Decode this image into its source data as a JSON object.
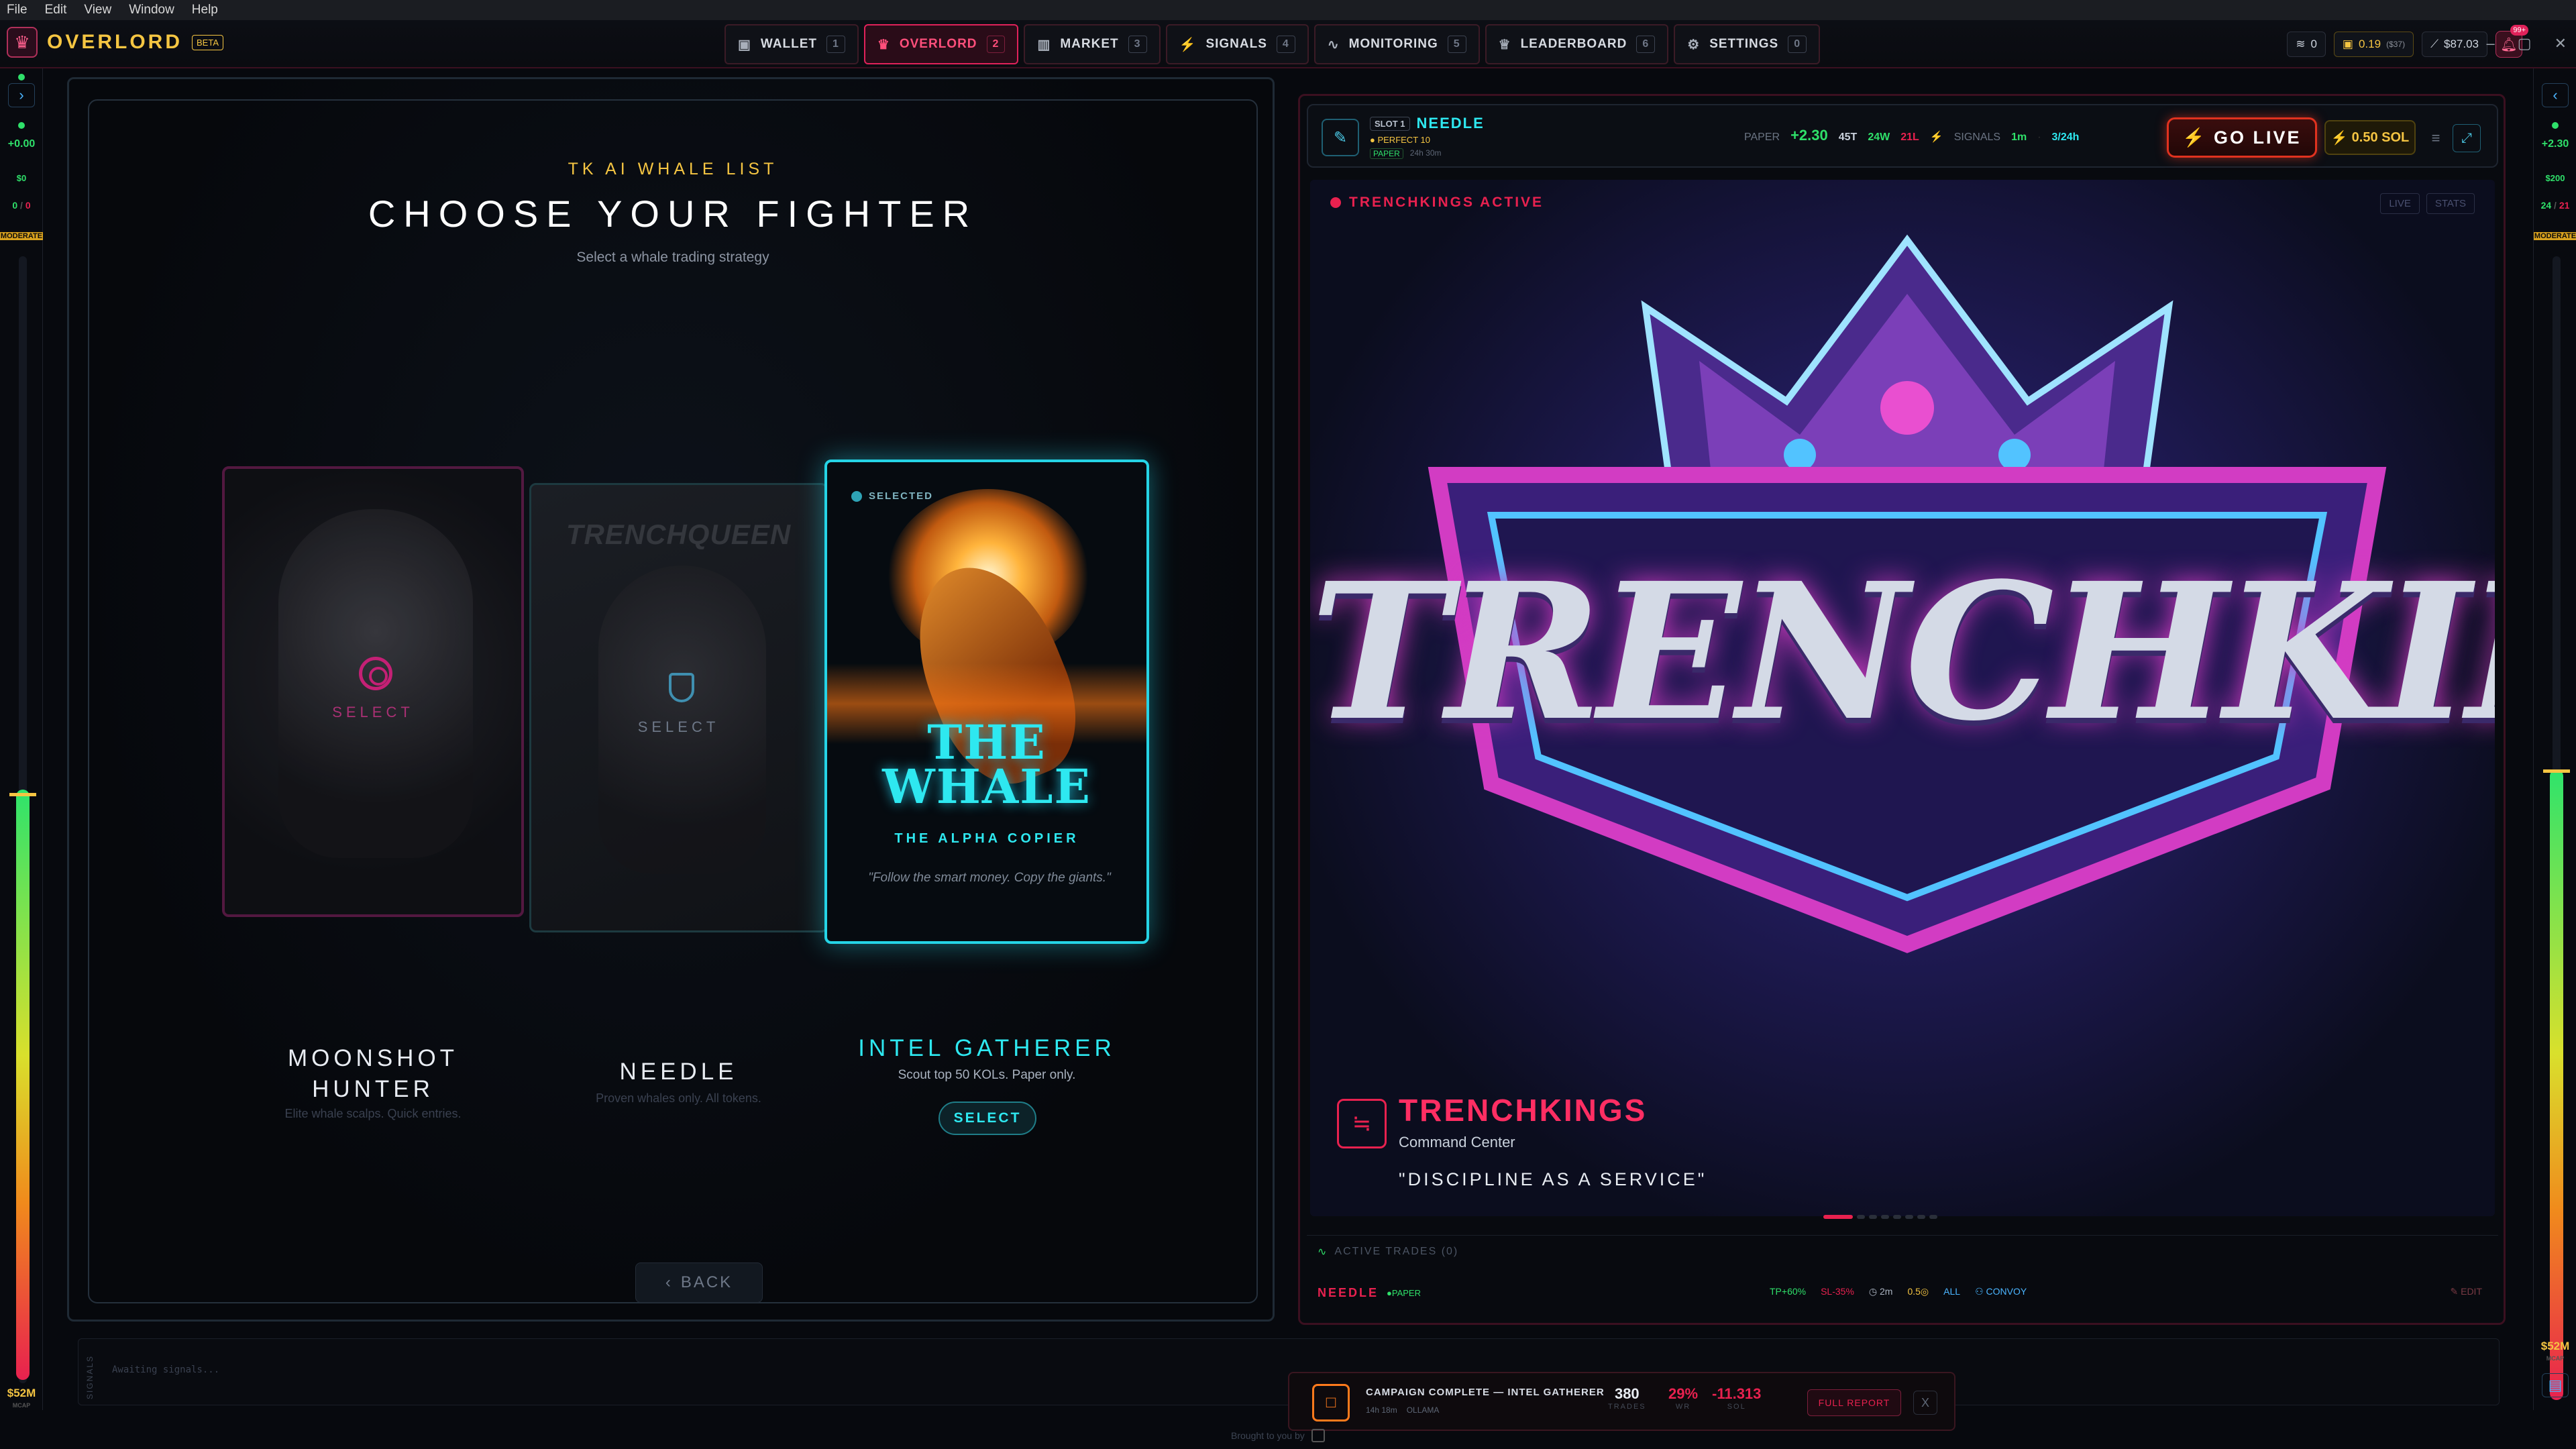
{
  "os_menu": [
    "File",
    "Edit",
    "View",
    "Window",
    "Help"
  ],
  "app": {
    "name": "OVERLORD",
    "badge": "BETA"
  },
  "nav_tabs": [
    {
      "label": "WALLET",
      "num": "1",
      "icon": "wallet-icon",
      "active": false
    },
    {
      "label": "OVERLORD",
      "num": "2",
      "icon": "crown-icon",
      "active": true
    },
    {
      "label": "MARKET",
      "num": "3",
      "icon": "bar-chart-icon",
      "active": false
    },
    {
      "label": "SIGNALS",
      "num": "4",
      "icon": "bolt-icon",
      "active": false
    },
    {
      "label": "MONITORING",
      "num": "5",
      "icon": "pulse-icon",
      "active": false
    },
    {
      "label": "LEADERBOARD",
      "num": "6",
      "icon": "crown-icon",
      "active": false
    },
    {
      "label": "SETTINGS",
      "num": "0",
      "icon": "gear-icon",
      "active": false
    }
  ],
  "header_stats": {
    "stack_count": "0",
    "balance": "0.19",
    "balance_usd": "($37)",
    "portfolio": "$87.03",
    "notifications": "99+"
  },
  "rail_left": {
    "pnl": "+0.00",
    "usd": "$0",
    "record_w": "0",
    "record_l": "0",
    "mode": "MODERATE",
    "bottom_value": "$52M",
    "bottom_label": "MCAP"
  },
  "rail_right": {
    "pnl": "+2.30",
    "usd": "$200",
    "record_w": "24",
    "record_l": "21",
    "mode": "MODERATE",
    "bottom_value": "$52M",
    "bottom_label": "MCAP"
  },
  "selector": {
    "kicker": "TK AI WHALE LIST",
    "title": "CHOOSE YOUR FIGHTER",
    "subtitle": "Select a whale trading strategy",
    "cards": [
      {
        "name": "MOONSHOT HUNTER",
        "desc": "Elite whale scalps. Quick entries.",
        "overlay": "SELECT"
      },
      {
        "name": "NEEDLE",
        "desc": "Proven whales only. All tokens.",
        "overlay": "SELECT",
        "art_text": "TRENCHQUEEN"
      },
      {
        "name": "INTEL GATHERER",
        "desc": "Scout top 50 KOLs. Paper only.",
        "selected_tag": "SELECTED",
        "art_title": "THE WHALE",
        "art_sub": "THE ALPHA COPIER",
        "art_quote": "\"Follow the smart money. Copy the giants.\""
      }
    ],
    "select_button": "SELECT",
    "back_button": "BACK"
  },
  "active_slot": {
    "slot": "SLOT 1",
    "name": "NEEDLE",
    "perfect": "PERFECT 10",
    "paper": "PAPER",
    "time": "24h 30m",
    "paper_label": "PAPER",
    "pnl": "+2.30",
    "trades": "45T",
    "wins": "24W",
    "losses": "21L",
    "signals_label": "SIGNALS",
    "signals_interval": "1m",
    "signals_count": "3/24h",
    "go_live": "GO LIVE",
    "sol": "0.50 SOL"
  },
  "hero": {
    "status": "TRENCHKINGS ACTIVE",
    "tabs": [
      "LIVE",
      "STATS"
    ],
    "logo": "TRENCHKINGS",
    "title": "TRENCHKINGS",
    "subtitle": "Command Center",
    "quote": "\"DISCIPLINE AS A SERVICE\""
  },
  "active_trades": "ACTIVE TRADES (0)",
  "bottom_strip": {
    "name": "NEEDLE",
    "paper": "PAPER",
    "tp": "TP+60%",
    "sl": "SL-35%",
    "time": "2m",
    "size": "0.5◎",
    "filter": "ALL",
    "convoy": "CONVOY",
    "edit": "EDIT"
  },
  "signals_strip": {
    "label": "SIGNALS",
    "waiting": "Awaiting signals..."
  },
  "campaign": {
    "title": "CAMPAIGN COMPLETE — INTEL GATHERER",
    "duration": "14h 18m",
    "model": "OLLAMA",
    "stats": [
      {
        "value": "380",
        "label": "TRADES",
        "color": "#e8ecf2"
      },
      {
        "value": "29%",
        "label": "WR",
        "color": "#e8214f"
      },
      {
        "value": "-11.313",
        "label": "SOL",
        "color": "#e8214f"
      }
    ],
    "report_button": "FULL REPORT",
    "close": "X"
  },
  "footer": "Brought to you by",
  "colors": {
    "accent": "#e8214f",
    "cyan": "#2ee8f0",
    "gold": "#f5c542",
    "green": "#2fe06a"
  }
}
